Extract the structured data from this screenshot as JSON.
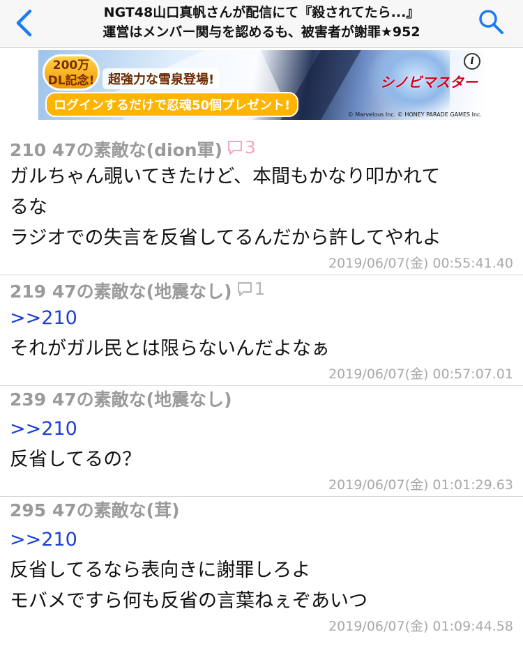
{
  "nav": {
    "title_line1": "NGT48山口真帆さんが配信にて『殺されてたら...』",
    "title_line2": "運営はメンバー関与を認めるも、被害者が謝罪★952"
  },
  "banner": {
    "badge_top": "200万",
    "badge_bottom": "DL記念!",
    "headline": "超強力な雪泉登場!",
    "promo": "ログインするだけで忍魂50個プレゼント!",
    "info_glyph": "i",
    "logo": "シノビマスター",
    "copyright": "© Marvelous Inc. © HONEY PARADE GAMES Inc."
  },
  "colors": {
    "reply_count_pink": "#f2a7c0",
    "reply_count_gray": "#b5b5b5",
    "anchor_blue": "#1a3fd8"
  },
  "posts": [
    {
      "header": "210 47の素敵な(dion軍)",
      "reply_count": "3",
      "bubble_color": "pink",
      "anchor": "",
      "lines": [
        "ガルちゃん覗いてきたけど、本間もかなり叩かれて",
        "るな",
        "ラジオでの失言を反省してるんだから許してやれよ"
      ],
      "date": "2019/06/07(金) 00:55:41.40"
    },
    {
      "header": "219 47の素敵な(地震なし)",
      "reply_count": "1",
      "bubble_color": "gray",
      "anchor": ">>210",
      "lines": [
        "それがガル民とは限らないんだよなぁ"
      ],
      "date": "2019/06/07(金) 00:57:07.01"
    },
    {
      "header": "239 47の素敵な(地震なし)",
      "reply_count": "",
      "bubble_color": "",
      "anchor": ">>210",
      "lines": [
        "反省してるの？"
      ],
      "date": "2019/06/07(金) 01:01:29.63"
    },
    {
      "header": "295 47の素敵な(茸)",
      "reply_count": "",
      "bubble_color": "",
      "anchor": ">>210",
      "lines": [
        "反省してるなら表向きに謝罪しろよ",
        "モバメですら何も反省の言葉ねぇぞあいつ"
      ],
      "date": "2019/06/07(金) 01:09:44.58"
    }
  ]
}
